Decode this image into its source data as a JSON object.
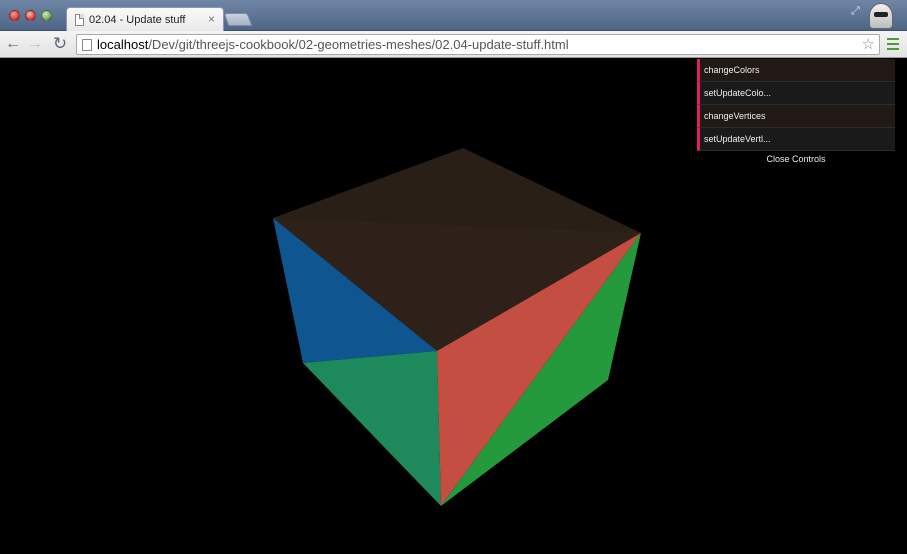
{
  "browser": {
    "tab_title": "02.04 - Update stuff",
    "tab_close": "×",
    "url_host": "localhost",
    "url_path": "/Dev/git/threejs-cookbook/02-geometries-meshes/02.04-update-stuff.html"
  },
  "icons": {
    "back": "back-arrow-icon",
    "forward": "forward-arrow-icon",
    "reload": "reload-icon",
    "star": "bookmark-star-icon",
    "menu": "menu-icon",
    "page": "page-icon",
    "profile": "profile-icon",
    "resize": "fullscreen-icon"
  },
  "gui": {
    "controls": [
      {
        "label": "changeColors"
      },
      {
        "label": "setUpdateColo..."
      },
      {
        "label": "changeVertices"
      },
      {
        "label": "setUpdateVertl..."
      }
    ],
    "close_label": "Close Controls"
  },
  "scene": {
    "background": "#000000",
    "face_colors": {
      "top": "#2a1f17",
      "left_blue": "#0f5590",
      "front_green_teal": "#1e8a5c",
      "right_red": "#c54e42",
      "right_green": "#249a3c"
    }
  }
}
